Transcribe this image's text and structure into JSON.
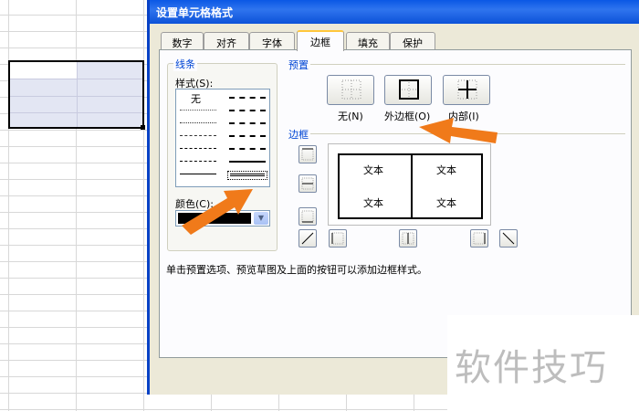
{
  "dialog": {
    "title": "设置单元格格式",
    "tabs": [
      "数字",
      "对齐",
      "字体",
      "边框",
      "填充",
      "保护"
    ],
    "active_tab": "边框"
  },
  "line": {
    "group_label": "线条",
    "style_label": "样式(S):",
    "style_none": "无",
    "color_label": "颜色(C):",
    "color_value": "#000000"
  },
  "presets": {
    "label": "预置",
    "items": [
      {
        "label": "无(N)",
        "icon": "no-border-icon"
      },
      {
        "label": "外边框(O)",
        "icon": "outline-border-icon"
      },
      {
        "label": "内部(I)",
        "icon": "inside-border-icon"
      }
    ]
  },
  "border": {
    "label": "边框",
    "preview_text": [
      "文本",
      "文本",
      "文本",
      "文本"
    ]
  },
  "hint": "单击预置选项、预览草图及上面的按钮可以添加边框样式。",
  "watermark": "软件技巧",
  "colors": {
    "titlebar": "#0a58e5",
    "arrow": "#f07a1a",
    "dialog_bg": "#ece9d8"
  }
}
